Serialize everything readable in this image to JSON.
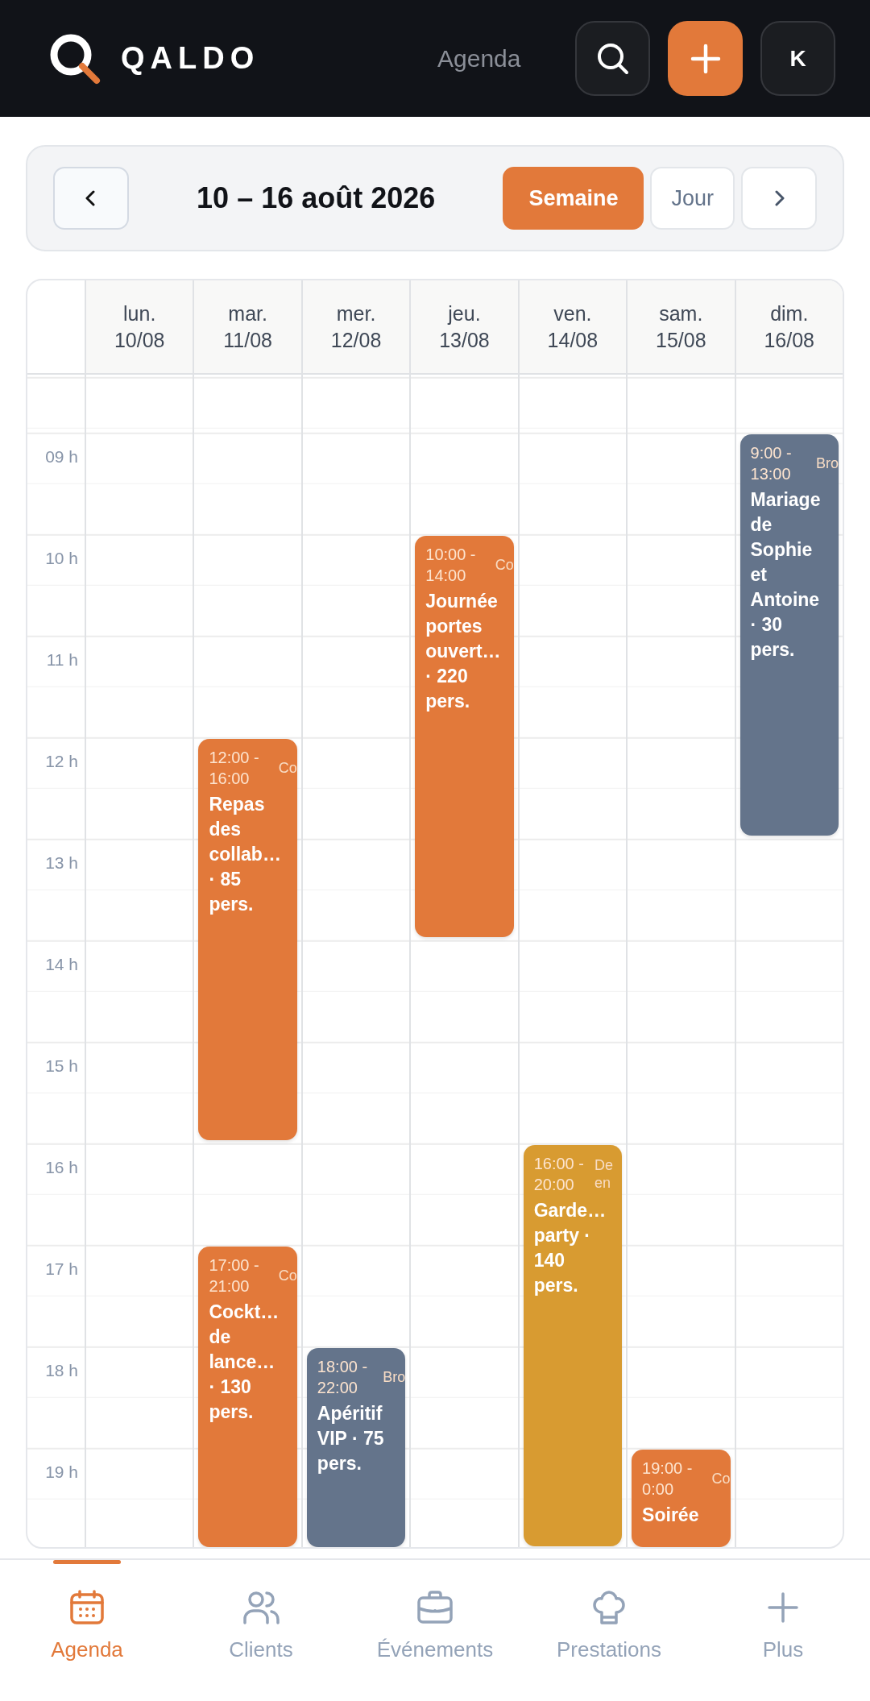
{
  "header": {
    "brand": "QALDO",
    "title": "Agenda",
    "avatar": "K"
  },
  "toolbar": {
    "range": "10 – 16 août 2026",
    "views": [
      {
        "label": "Semaine",
        "selected": true
      },
      {
        "label": "Jour",
        "selected": false
      }
    ]
  },
  "calendar": {
    "hours": [
      "09 h",
      "10 h",
      "11 h",
      "12 h",
      "13 h",
      "14 h",
      "15 h",
      "16 h",
      "17 h",
      "18 h",
      "19 h"
    ],
    "days": [
      {
        "name": "lun.",
        "date": "10/08"
      },
      {
        "name": "mar.",
        "date": "11/08",
        "events": [
          {
            "time": "12:00 - 16:00",
            "tag": "Co",
            "title": "Repas des collab… · 85 pers.",
            "color": "#e2793a"
          },
          {
            "time": "17:00 - 21:00",
            "tag": "Co",
            "title": "Cockt… de lance… · 130 pers.",
            "color": "#e2793a"
          }
        ]
      },
      {
        "name": "mer.",
        "date": "12/08",
        "events": [
          {
            "time": "18:00 - 22:00",
            "tag": "Bro",
            "title": "Apéritif VIP · 75 pers.",
            "color": "#64748b"
          }
        ]
      },
      {
        "name": "jeu.",
        "date": "13/08",
        "events": [
          {
            "time": "10:00 - 14:00",
            "tag": "Co",
            "title": "Journée portes ouvert… · 220 pers.",
            "color": "#e2793a"
          }
        ]
      },
      {
        "name": "ven.",
        "date": "14/08",
        "events": [
          {
            "time": "16:00 - 20:00",
            "tag": "De en",
            "title": "Garde… party · 140 pers.",
            "color": "#d89b31"
          }
        ]
      },
      {
        "name": "sam.",
        "date": "15/08",
        "events": [
          {
            "time": "19:00 - 0:00",
            "tag": "Co",
            "title": "Soirée",
            "color": "#e2793a"
          }
        ]
      },
      {
        "name": "dim.",
        "date": "16/08",
        "events": [
          {
            "time": "9:00 - 13:00",
            "tag": "Bro",
            "title": "Mariage de Sophie et Antoine · 30 pers.",
            "color": "#64748b"
          }
        ]
      }
    ]
  },
  "nav": [
    {
      "label": "Agenda",
      "selected": true
    },
    {
      "label": "Clients",
      "selected": false
    },
    {
      "label": "Événements",
      "selected": false
    },
    {
      "label": "Prestations",
      "selected": false
    },
    {
      "label": "Plus",
      "selected": false
    }
  ]
}
